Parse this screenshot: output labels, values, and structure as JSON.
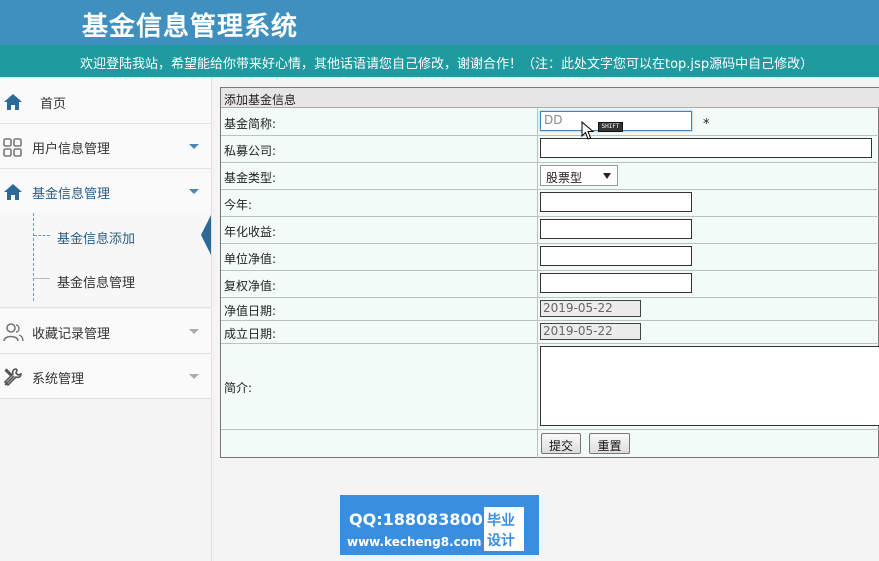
{
  "header": {
    "title": "基金信息管理系统",
    "banner": "欢迎登陆我站，希望能给你带来好心情，其他话语请您自己修改，谢谢合作！（注：此处文字您可以在top.jsp源码中自己修改）"
  },
  "sidebar": {
    "items": [
      {
        "label": "首页",
        "icon": "home-icon"
      },
      {
        "label": "用户信息管理",
        "icon": "grid-icon"
      },
      {
        "label": "基金信息管理",
        "icon": "home-icon"
      },
      {
        "label": "收藏记录管理",
        "icon": "users-icon"
      },
      {
        "label": "系统管理",
        "icon": "wrench-icon"
      }
    ],
    "sub_items": [
      {
        "label": "基金信息添加"
      },
      {
        "label": "基金信息管理"
      }
    ]
  },
  "form": {
    "title": "添加基金信息",
    "fields": [
      {
        "label": "基金简称:",
        "value": "DD"
      },
      {
        "label": "私募公司:",
        "value": ""
      },
      {
        "label": "基金类型:",
        "value": "股票型"
      },
      {
        "label": "今年:",
        "value": ""
      },
      {
        "label": "年化收益:",
        "value": ""
      },
      {
        "label": "单位净值:",
        "value": ""
      },
      {
        "label": "复权净值:",
        "value": ""
      },
      {
        "label": "净值日期:",
        "value": "2019-05-22"
      },
      {
        "label": "成立日期:",
        "value": "2019-05-22"
      },
      {
        "label": "简介:",
        "value": ""
      }
    ],
    "required_mark": "*",
    "submit_label": "提交",
    "reset_label": "重置"
  },
  "overlay": {
    "shift_badge": "SHIFT"
  },
  "watermark": {
    "qq": "QQ:188083800",
    "site": "www.kecheng8.com",
    "tag_line1": "毕业",
    "tag_line2": "设计"
  },
  "colors": {
    "header": "#3f8fbf",
    "banner": "#1f9aa0",
    "accent": "#2b6a99",
    "form_bg": "#f2fbf8",
    "watermark": "#3a8ee0"
  }
}
